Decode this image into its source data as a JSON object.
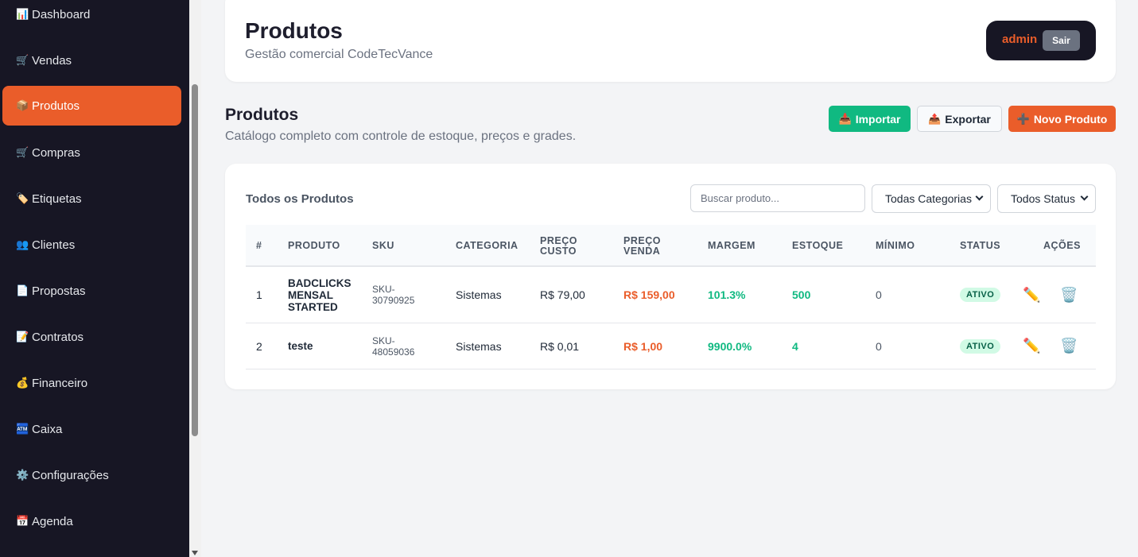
{
  "sidebar": {
    "items": [
      {
        "icon": "📊",
        "label": "Dashboard",
        "active": false
      },
      {
        "icon": "🛒",
        "label": "Vendas",
        "active": false
      },
      {
        "icon": "📦",
        "label": "Produtos",
        "active": true
      },
      {
        "icon": "🛒",
        "label": "Compras",
        "active": false
      },
      {
        "icon": "🏷️",
        "label": "Etiquetas",
        "active": false
      },
      {
        "icon": "👥",
        "label": "Clientes",
        "active": false
      },
      {
        "icon": "📄",
        "label": "Propostas",
        "active": false
      },
      {
        "icon": "📝",
        "label": "Contratos",
        "active": false
      },
      {
        "icon": "💰",
        "label": "Financeiro",
        "active": false
      },
      {
        "icon": "🏧",
        "label": "Caixa",
        "active": false
      },
      {
        "icon": "⚙️",
        "label": "Configurações",
        "active": false
      },
      {
        "icon": "📅",
        "label": "Agenda",
        "active": false
      }
    ]
  },
  "header": {
    "title": "Produtos",
    "subtitle": "Gestão comercial CodeTecVance",
    "user": "admin",
    "logout_label": "Sair"
  },
  "page": {
    "title": "Produtos",
    "description": "Catálogo completo com controle de estoque, preços e grades."
  },
  "actions": {
    "import_label": "Importar",
    "export_label": "Exportar",
    "new_label": "Novo Produto"
  },
  "table_card": {
    "title": "Todos os Produtos",
    "search_placeholder": "Buscar produto...",
    "category_filter": "Todas Categorias",
    "status_filter": "Todos Status"
  },
  "table": {
    "columns": [
      "#",
      "PRODUTO",
      "SKU",
      "CATEGORIA",
      "PREÇO CUSTO",
      "PREÇO VENDA",
      "MARGEM",
      "ESTOQUE",
      "MÍNIMO",
      "STATUS",
      "AÇÕES"
    ],
    "rows": [
      {
        "num": "1",
        "product": "BADCLICKS MENSAL STARTED",
        "sku": "SKU-30790925",
        "category": "Sistemas",
        "cost": "R$ 79,00",
        "price": "R$ 159,00",
        "margin": "101.3%",
        "stock": "500",
        "minimum": "0",
        "status": "ATIVO"
      },
      {
        "num": "2",
        "product": "teste",
        "sku": "SKU-48059036",
        "category": "Sistemas",
        "cost": "R$ 0,01",
        "price": "R$ 1,00",
        "margin": "9900.0%",
        "stock": "4",
        "minimum": "0",
        "status": "ATIVO"
      }
    ]
  },
  "colors": {
    "accent": "#ea5d2a",
    "success": "#10b981",
    "sidebar_bg": "#171624"
  }
}
